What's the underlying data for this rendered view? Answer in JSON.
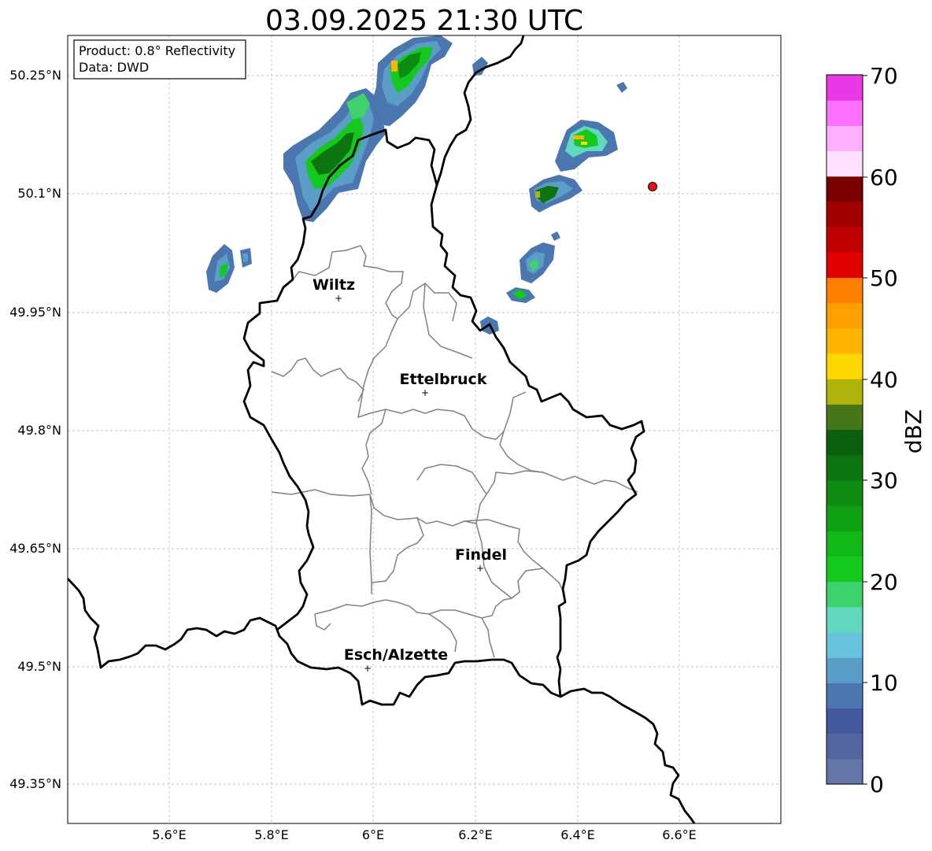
{
  "title": "03.09.2025 21:30 UTC",
  "info": {
    "product": "Product: 0.8° Reflectivity",
    "data": "Data: DWD"
  },
  "axes": {
    "x_ticks": [
      "5.6°E",
      "5.8°E",
      "6°E",
      "6.2°E",
      "6.4°E",
      "6.6°E"
    ],
    "y_ticks": [
      "50.25°N",
      "50.1°N",
      "49.95°N",
      "49.8°N",
      "49.65°N",
      "49.5°N",
      "49.35°N"
    ]
  },
  "cities": [
    {
      "name": "Wiltz"
    },
    {
      "name": "Ettelbruck"
    },
    {
      "name": "Findel"
    },
    {
      "name": "Esch/Alzette"
    }
  ],
  "colorbar": {
    "label": "dBZ",
    "ticks": [
      "0",
      "10",
      "20",
      "30",
      "40",
      "50",
      "60",
      "70"
    ],
    "colors": [
      "#6475a8",
      "#5366a0",
      "#42599f",
      "#4a77b0",
      "#5a9ec8",
      "#67c4dc",
      "#62d8c0",
      "#3dd26c",
      "#14c81e",
      "#12b816",
      "#10a014",
      "#0e8c12",
      "#0c7410",
      "#0a600e",
      "#467618",
      "#b0b40a",
      "#ffd800",
      "#ffb400",
      "#ffa000",
      "#ff8000",
      "#e00000",
      "#c00000",
      "#a00000",
      "#7a0000",
      "#ffe0ff",
      "#ffb0ff",
      "#ff70ff",
      "#e838e8"
    ]
  }
}
